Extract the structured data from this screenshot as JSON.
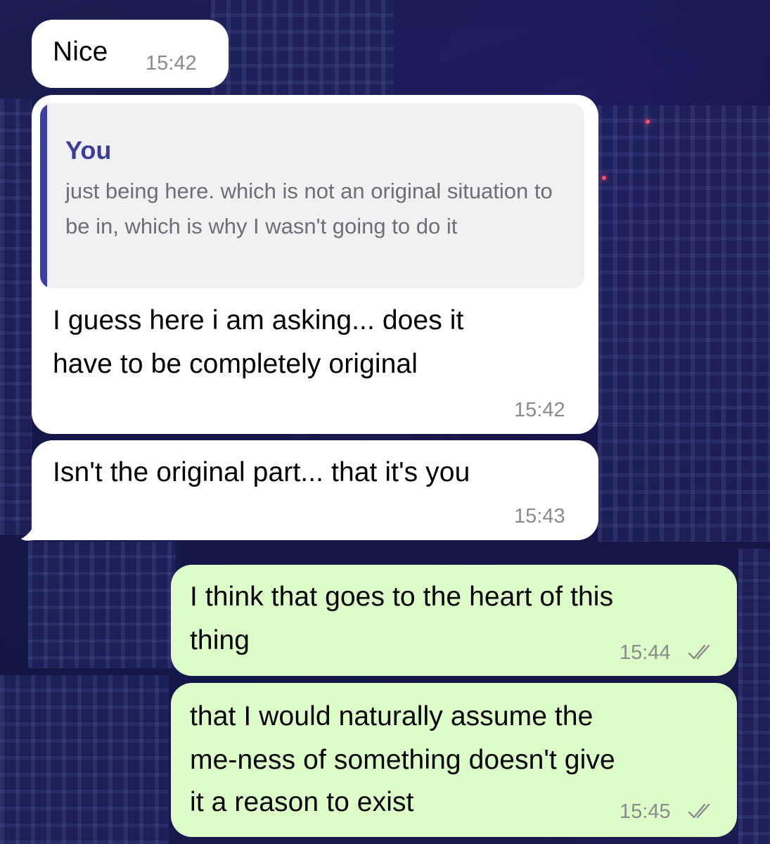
{
  "messages": [
    {
      "text": "Nice",
      "time": "15:42"
    },
    {
      "reply_to": {
        "author": "You",
        "text": "just being here. which is not an original situation to be in, which is why I wasn't going to do it"
      },
      "text_lines": [
        "I guess here i am asking... does it",
        "have to be completely original"
      ],
      "time": "15:42"
    },
    {
      "text": "Isn't the original part... that it's you",
      "time": "15:43"
    },
    {
      "text_lines": [
        "I think that goes to the heart of this",
        "thing"
      ],
      "time": "15:44",
      "status": "read"
    },
    {
      "text_lines": [
        "that I would naturally assume the",
        "me-ness of something doesn't give",
        "it a reason to exist"
      ],
      "time": "15:45",
      "status": "read"
    }
  ],
  "colors": {
    "incoming_bubble": "#ffffff",
    "outgoing_bubble": "#dcfcc8",
    "quote_accent": "#3d3fa8",
    "timestamp": "#8a8a8e"
  },
  "icons": {
    "read_receipt": "double-check-icon"
  }
}
